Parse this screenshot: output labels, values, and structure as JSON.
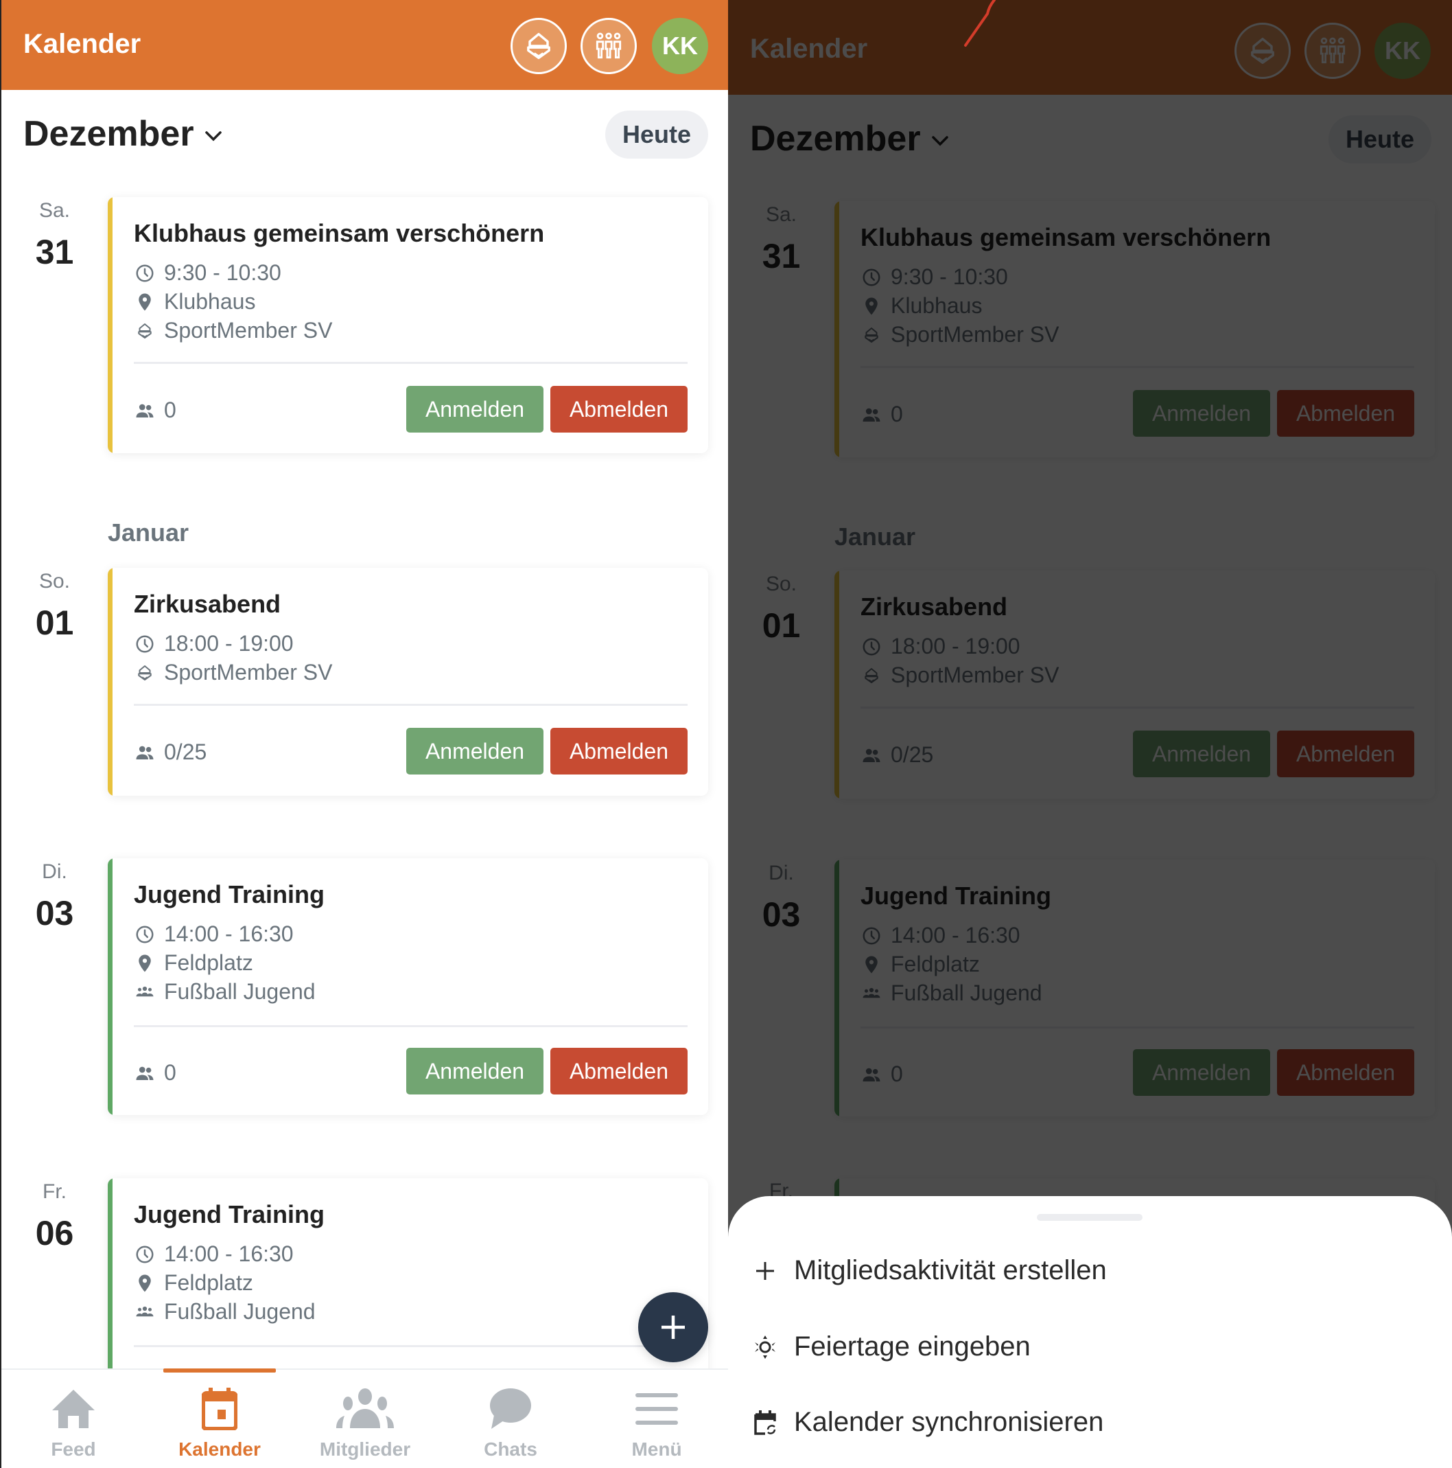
{
  "app": {
    "title": "Kalender",
    "header_icons": [
      "club-icon",
      "groups-icon"
    ],
    "avatar_initials": "KK",
    "brand_color": "#DD7430"
  },
  "toolbar": {
    "month": "Dezember",
    "today_label": "Heute"
  },
  "month_separator": "Januar",
  "events": [
    {
      "weekday": "Sa.",
      "day": "31",
      "title": "Klubhaus gemeinsam verschönern",
      "time": "9:30 - 10:30",
      "location": "Klubhaus",
      "organizer": "SportMember SV",
      "organizer_icon": "club-icon",
      "attendees": "0",
      "accent": "#E8C23E",
      "signup_label": "Anmelden",
      "signoff_label": "Abmelden"
    },
    {
      "weekday": "So.",
      "day": "01",
      "title": "Zirkusabend",
      "time": "18:00 - 19:00",
      "location": null,
      "organizer": "SportMember SV",
      "organizer_icon": "club-icon",
      "attendees": "0/25",
      "accent": "#E8C23E",
      "signup_label": "Anmelden",
      "signoff_label": "Abmelden"
    },
    {
      "weekday": "Di.",
      "day": "03",
      "title": "Jugend Training",
      "time": "14:00 - 16:30",
      "location": "Feldplatz",
      "organizer": "Fußball Jugend",
      "organizer_icon": "group-icon",
      "attendees": "0",
      "accent": "#5FA864",
      "signup_label": "Anmelden",
      "signoff_label": "Abmelden"
    },
    {
      "weekday": "Fr.",
      "day": "06",
      "title": "Jugend Training",
      "time": "14:00 - 16:30",
      "location": "Feldplatz",
      "organizer": "Fußball Jugend",
      "organizer_icon": "group-icon",
      "accent": "#5FA864"
    }
  ],
  "fab_icon": "plus-icon",
  "bottom_nav": [
    {
      "label": "Feed",
      "icon": "home-icon",
      "active": false
    },
    {
      "label": "Kalender",
      "icon": "calendar-icon",
      "active": true
    },
    {
      "label": "Mitglieder",
      "icon": "members-icon",
      "active": false
    },
    {
      "label": "Chats",
      "icon": "chat-icon",
      "active": false
    },
    {
      "label": "Menü",
      "icon": "menu-icon",
      "active": false
    }
  ],
  "action_sheet": {
    "items": [
      {
        "label": "Mitgliedsaktivität erstellen",
        "icon": "plus-icon"
      },
      {
        "label": "Feiertage eingeben",
        "icon": "holiday-icon"
      },
      {
        "label": "Kalender synchronisieren",
        "icon": "calendar-sync-icon"
      }
    ]
  },
  "colors": {
    "signup": "#72A572",
    "signoff": "#C74B32",
    "fab": "#29374A"
  }
}
